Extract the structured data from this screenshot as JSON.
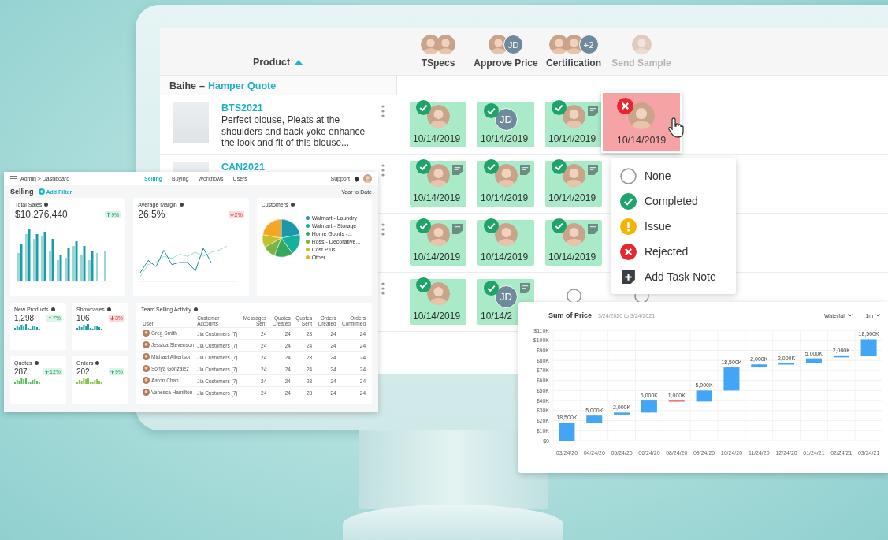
{
  "main_table": {
    "product_header": "Product",
    "task_columns": [
      {
        "label": "TSpecs",
        "dimmed": false,
        "assignees": [
          {
            "kind": "photo"
          },
          {
            "kind": "photo"
          }
        ]
      },
      {
        "label": "Approve Price",
        "dimmed": false,
        "assignees": [
          {
            "kind": "photo"
          },
          {
            "kind": "initials",
            "text": "JD"
          }
        ]
      },
      {
        "label": "Certification",
        "dimmed": false,
        "assignees": [
          {
            "kind": "photo"
          },
          {
            "kind": "photo"
          },
          {
            "kind": "initials",
            "text": "+2"
          }
        ]
      },
      {
        "label": "Send Sample",
        "dimmed": true,
        "assignees": [
          {
            "kind": "photo"
          }
        ]
      }
    ],
    "group": {
      "customer": "Baihe",
      "separator": "–",
      "quote": "Hamper Quote"
    },
    "rows": [
      {
        "code": "BTS2021",
        "description": "Perfect blouse, Pleats at the shoulders and back yoke enhance the look and fit of this blouse...",
        "cells": [
          {
            "kind": "completed",
            "assignee": {
              "kind": "photo"
            },
            "note": false,
            "date": "10/14/2019",
            "selected": false
          },
          {
            "kind": "completed",
            "assignee": {
              "kind": "initials",
              "text": "JD"
            },
            "note": false,
            "date": "10/14/2019",
            "selected": false
          },
          {
            "kind": "completed",
            "assignee": {
              "kind": "photo"
            },
            "note": true,
            "date": "10/14/2019",
            "selected": false
          },
          {
            "kind": "rejected",
            "assignee": {
              "kind": "photo"
            },
            "note": false,
            "date": "10/14/2019",
            "selected": true
          }
        ]
      },
      {
        "code": "CAN2021",
        "cells": [
          {
            "kind": "completed",
            "assignee": {
              "kind": "photo"
            },
            "note": true,
            "date": "10/14/2019",
            "selected": false
          },
          {
            "kind": "completed",
            "assignee": {
              "kind": "photo"
            },
            "note": true,
            "date": "10/14/2019",
            "selected": false
          },
          {
            "kind": "completed",
            "assignee": {
              "kind": "photo"
            },
            "note": true,
            "date": "10/14/2019",
            "selected": false
          }
        ]
      },
      {
        "cells": [
          {
            "kind": "completed",
            "assignee": {
              "kind": "photo"
            },
            "note": true,
            "date": "10/14/2019",
            "selected": false
          },
          {
            "kind": "completed",
            "assignee": {
              "kind": "photo"
            },
            "note": false,
            "date": "10/14/2019",
            "selected": false
          },
          {
            "kind": "completed",
            "assignee": {
              "kind": "photo"
            },
            "note": true,
            "date": "10/14/2019",
            "selected": false
          }
        ]
      },
      {
        "cells": [
          {
            "kind": "completed",
            "assignee": {
              "kind": "photo"
            },
            "note": false,
            "date": "10/14/2019",
            "selected": false
          },
          {
            "kind": "completed",
            "assignee": {
              "kind": "initials",
              "text": "JD"
            },
            "note": true,
            "date": "10/14/2",
            "selected": false
          },
          {
            "kind": "none",
            "selected": false
          },
          {
            "kind": "none",
            "selected": false
          }
        ]
      }
    ]
  },
  "status_menu": {
    "items": [
      {
        "kind": "none",
        "label": "None"
      },
      {
        "kind": "completed",
        "label": "Completed"
      },
      {
        "kind": "issue",
        "label": "Issue"
      },
      {
        "kind": "rejected",
        "label": "Rejected"
      },
      {
        "kind": "note",
        "label": "Add Task Note"
      }
    ]
  },
  "dashboard": {
    "breadcrumb": "Admin > Dashboard",
    "tabs": [
      {
        "label": "Selling",
        "selected": true
      },
      {
        "label": "Buying",
        "selected": false
      },
      {
        "label": "Workflows",
        "selected": false
      },
      {
        "label": "Users",
        "selected": false
      }
    ],
    "support": "Support",
    "page_title": "Selling",
    "add_filter": "Add Filter",
    "period": "Year to Date",
    "big_cards": [
      {
        "kind": "bars",
        "title": "Total Sales",
        "value": "$10,276,440",
        "change": "9%",
        "positive": true
      },
      {
        "kind": "lines",
        "title": "Average Margin",
        "value": "26.5%",
        "change": "2%",
        "positive": false
      }
    ],
    "customers": {
      "title": "Customers",
      "legend": [
        {
          "name": "Walmart - Laundry",
          "color": "#1a97a8"
        },
        {
          "name": "Walmart - Storage",
          "color": "#17b09b"
        },
        {
          "name": "Home Goods -...",
          "color": "#35a85e"
        },
        {
          "name": "Ross - Decorative...",
          "color": "#7cb342"
        },
        {
          "name": "Cost Plus",
          "color": "#c4c22b"
        },
        {
          "name": "Other",
          "color": "#f5a623"
        }
      ]
    },
    "small_cards": [
      {
        "title": "New Products",
        "value": "1,298",
        "change": "7%",
        "positive": true,
        "color": "#1a9fa8"
      },
      {
        "title": "Showcases",
        "value": "106",
        "change": "3%",
        "positive": false,
        "color": "#1a9fa8"
      },
      {
        "title": "Quotes",
        "value": "287",
        "change": "12%",
        "positive": true,
        "color": "#5cb85c"
      },
      {
        "title": "Orders",
        "value": "202",
        "change": "9%",
        "positive": true,
        "color": "#8bc34a"
      }
    ],
    "activity": {
      "title": "Team Selling Activity",
      "columns": [
        "User",
        "Customer Accounts",
        "Messages Sent",
        "Quotes Created",
        "Quotes Sent",
        "Orders Created",
        "Orders Confirmed"
      ],
      "rows": [
        {
          "user": "Greg Smith",
          "values": [
            "Jia Customers (7)",
            "24",
            "24",
            "28",
            "24",
            "24"
          ]
        },
        {
          "user": "Jessica Stevenson",
          "values": [
            "Jia Customers (7)",
            "24",
            "24",
            "24",
            "24",
            "24"
          ]
        },
        {
          "user": "Michael Albertson",
          "values": [
            "Jia Customers (7)",
            "24",
            "24",
            "28",
            "24",
            "24"
          ]
        },
        {
          "user": "Sonya Gonzalez",
          "values": [
            "Jia Customers (7)",
            "24",
            "24",
            "24",
            "24",
            "24"
          ]
        },
        {
          "user": "Aaron Chan",
          "values": [
            "Jia Customers (7)",
            "24",
            "24",
            "28",
            "24",
            "24"
          ]
        },
        {
          "user": "Vanessa Hamilton",
          "values": [
            "Jia Customers (7)",
            "24",
            "24",
            "28",
            "24",
            "24"
          ]
        }
      ]
    }
  },
  "price_chart": {
    "title": "Sum of Price",
    "date_range": "3/24/2020 to 3/24/2021",
    "view_select": "Waterfall",
    "interval_select": "1m",
    "chart_data": {
      "type": "candlestick",
      "grid": true,
      "categories": [
        "03/24/20",
        "04/24/20",
        "05/24/20",
        "06/24/20",
        "08/24/20",
        "09/24/20",
        "10/24/20",
        "11/24/20",
        "12/24/20",
        "01/24/21",
        "02/24/21",
        "03/24/21"
      ],
      "ohlc": [
        [
          0,
          18,
          0,
          18
        ],
        [
          18,
          25,
          18,
          25
        ],
        [
          26,
          28,
          26,
          28
        ],
        [
          28,
          40,
          28,
          40
        ],
        [
          40,
          40,
          39,
          39
        ],
        [
          39,
          50,
          39,
          50
        ],
        [
          50,
          73,
          50,
          73
        ],
        [
          73,
          76,
          73,
          76
        ],
        [
          76,
          77,
          76,
          77
        ],
        [
          77,
          82,
          77,
          82
        ],
        [
          83,
          85,
          83,
          85
        ],
        [
          84,
          101,
          84,
          101
        ]
      ],
      "annotations": [
        "18,500K",
        "5,000K",
        "2,000K",
        "6,000K",
        "1,000K",
        "5,000K",
        "18,500K",
        "2,000K",
        "2,000K",
        "5,000K",
        "2,000K",
        "18,500K"
      ],
      "ylim": [
        0,
        110
      ],
      "yticks": [
        {
          "value": 0,
          "label": "$0"
        },
        {
          "value": 10,
          "label": "$10K"
        },
        {
          "value": 20,
          "label": "$20K"
        },
        {
          "value": 30,
          "label": "$30K"
        },
        {
          "value": 40,
          "label": "$40K"
        },
        {
          "value": 50,
          "label": "$50K"
        },
        {
          "value": 60,
          "label": "$60K"
        },
        {
          "value": 70,
          "label": "$70K"
        },
        {
          "value": 80,
          "label": "$80K"
        },
        {
          "value": 90,
          "label": "$90K"
        },
        {
          "value": 100,
          "label": "$100K"
        },
        {
          "value": 110,
          "label": "$110K"
        }
      ]
    }
  }
}
